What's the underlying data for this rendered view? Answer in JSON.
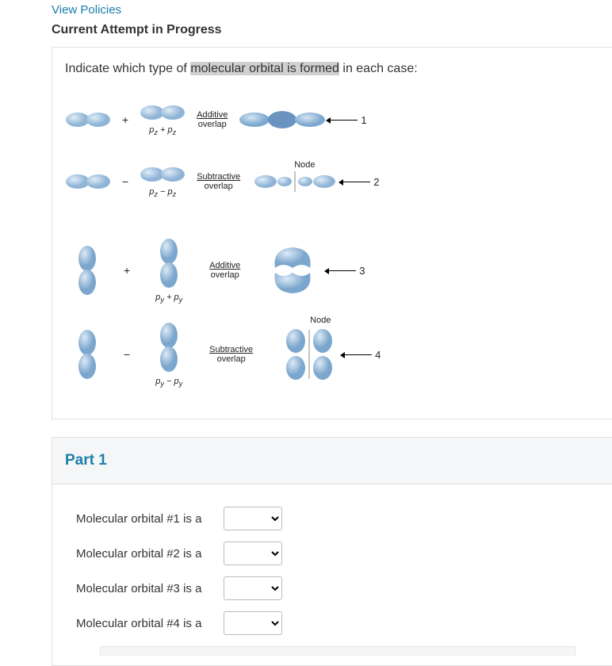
{
  "header": {
    "policies_link": "View Policies",
    "attempt_title": "Current Attempt in Progress"
  },
  "question": {
    "prefix": "Indicate which type of ",
    "highlighted": "molecular orbital is formed",
    "suffix": " in each case:"
  },
  "rows": [
    {
      "op": "+",
      "formula": "pᵣ + pᵣ",
      "arrow_top": "Additive",
      "arrow_bottom": "overlap",
      "num": "1",
      "has_node": false,
      "orientation": "horizontal",
      "formula_text": "p_z + p_z"
    },
    {
      "op": "−",
      "formula": "pᵣ − pᵣ",
      "arrow_top": "Subtractive",
      "arrow_bottom": "overlap",
      "num": "2",
      "has_node": true,
      "orientation": "horizontal",
      "formula_text": "p_z − p_z"
    },
    {
      "op": "+",
      "formula": "pᵧ + pᵧ",
      "arrow_top": "Additive",
      "arrow_bottom": "overlap",
      "num": "3",
      "has_node": false,
      "orientation": "vertical",
      "formula_text": "p_y + p_y"
    },
    {
      "op": "−",
      "formula": "pᵧ − pᵧ",
      "arrow_top": "Subtractive",
      "arrow_bottom": "overlap",
      "num": "4",
      "has_node": true,
      "orientation": "vertical",
      "formula_text": "p_y − p_y"
    }
  ],
  "node_label": "Node",
  "part1": {
    "title": "Part 1",
    "items": [
      {
        "label": "Molecular orbital #1 is a"
      },
      {
        "label": "Molecular orbital #2 is a"
      },
      {
        "label": "Molecular orbital #3 is a"
      },
      {
        "label": "Molecular orbital #4 is a"
      }
    ]
  }
}
